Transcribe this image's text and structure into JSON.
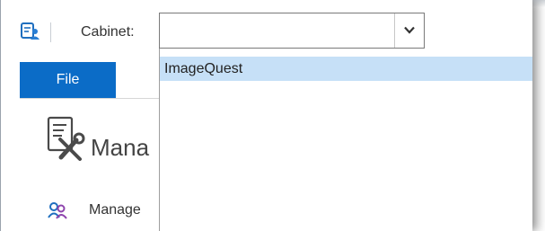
{
  "toolbar": {
    "app_icon": "cabinet-person-icon",
    "cabinet_label": "Cabinet:",
    "cabinet_value": "",
    "dropdown_icon": "chevron-down-icon"
  },
  "ribbon": {
    "file_tab": "File",
    "manage_big_label": "Mana",
    "manage_big_icon": "document-tools-icon",
    "manage_small_label": "Manage",
    "manage_small_icon": "users-icon"
  },
  "dropdown": {
    "options": [
      "ImageQuest"
    ],
    "highlighted_index": 0
  },
  "colors": {
    "accent": "#0b6cc7",
    "highlight": "#c6e0f7"
  }
}
